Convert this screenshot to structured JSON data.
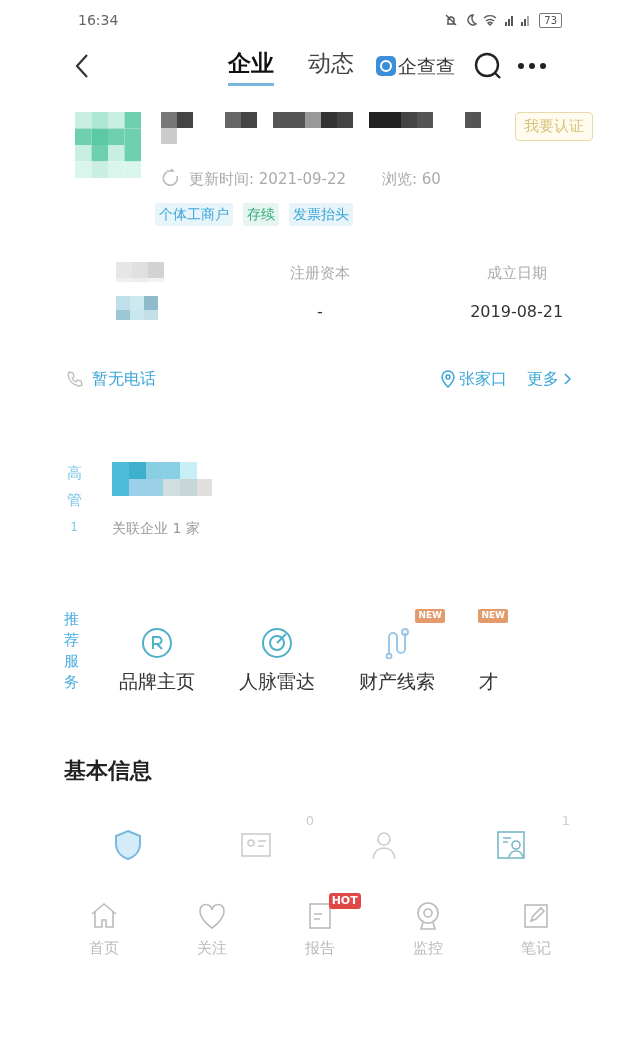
{
  "status_bar": {
    "time": "16:34",
    "battery": "73"
  },
  "header": {
    "tabs": [
      {
        "label": "企业",
        "selected": true
      },
      {
        "label": "动态",
        "selected": false
      }
    ],
    "brand": "企查查"
  },
  "company": {
    "claim_button": "我要认证",
    "update_time": "更新时间: 2021-09-22",
    "views": "浏览: 60",
    "tags": [
      {
        "label": "个体工商户",
        "color": "#3aa6d8"
      },
      {
        "label": "存续",
        "color": "#2fae7a"
      },
      {
        "label": "发票抬头",
        "color": "#3aa6d8"
      }
    ]
  },
  "stats": [
    {
      "label": "注册资本",
      "value": "-"
    },
    {
      "label": "成立日期",
      "value": "2019-08-21"
    }
  ],
  "contact": {
    "phone": "暂无电话",
    "location": "张家口",
    "more": "更多"
  },
  "executives": {
    "side_label": "高管",
    "count": "1",
    "related": "关联企业 1 家"
  },
  "services": {
    "side_label": "推荐服务",
    "items": [
      {
        "label": "品牌主页",
        "kind": "registered"
      },
      {
        "label": "人脉雷达",
        "kind": "radar"
      },
      {
        "label": "财产线索",
        "kind": "route",
        "badge": "NEW"
      },
      {
        "label": "才",
        "kind": "cut",
        "badge": "NEW"
      }
    ]
  },
  "basic_info": {
    "title": "基本信息",
    "items": [
      {
        "kind": "shield"
      },
      {
        "kind": "card",
        "count": "0"
      },
      {
        "kind": "person"
      },
      {
        "kind": "profile",
        "count": "1"
      }
    ]
  },
  "bottom_nav": [
    {
      "label": "首页",
      "kind": "home"
    },
    {
      "label": "关注",
      "kind": "heart"
    },
    {
      "label": "报告",
      "kind": "report",
      "badge": "HOT"
    },
    {
      "label": "监控",
      "kind": "camera"
    },
    {
      "label": "笔记",
      "kind": "note"
    }
  ]
}
